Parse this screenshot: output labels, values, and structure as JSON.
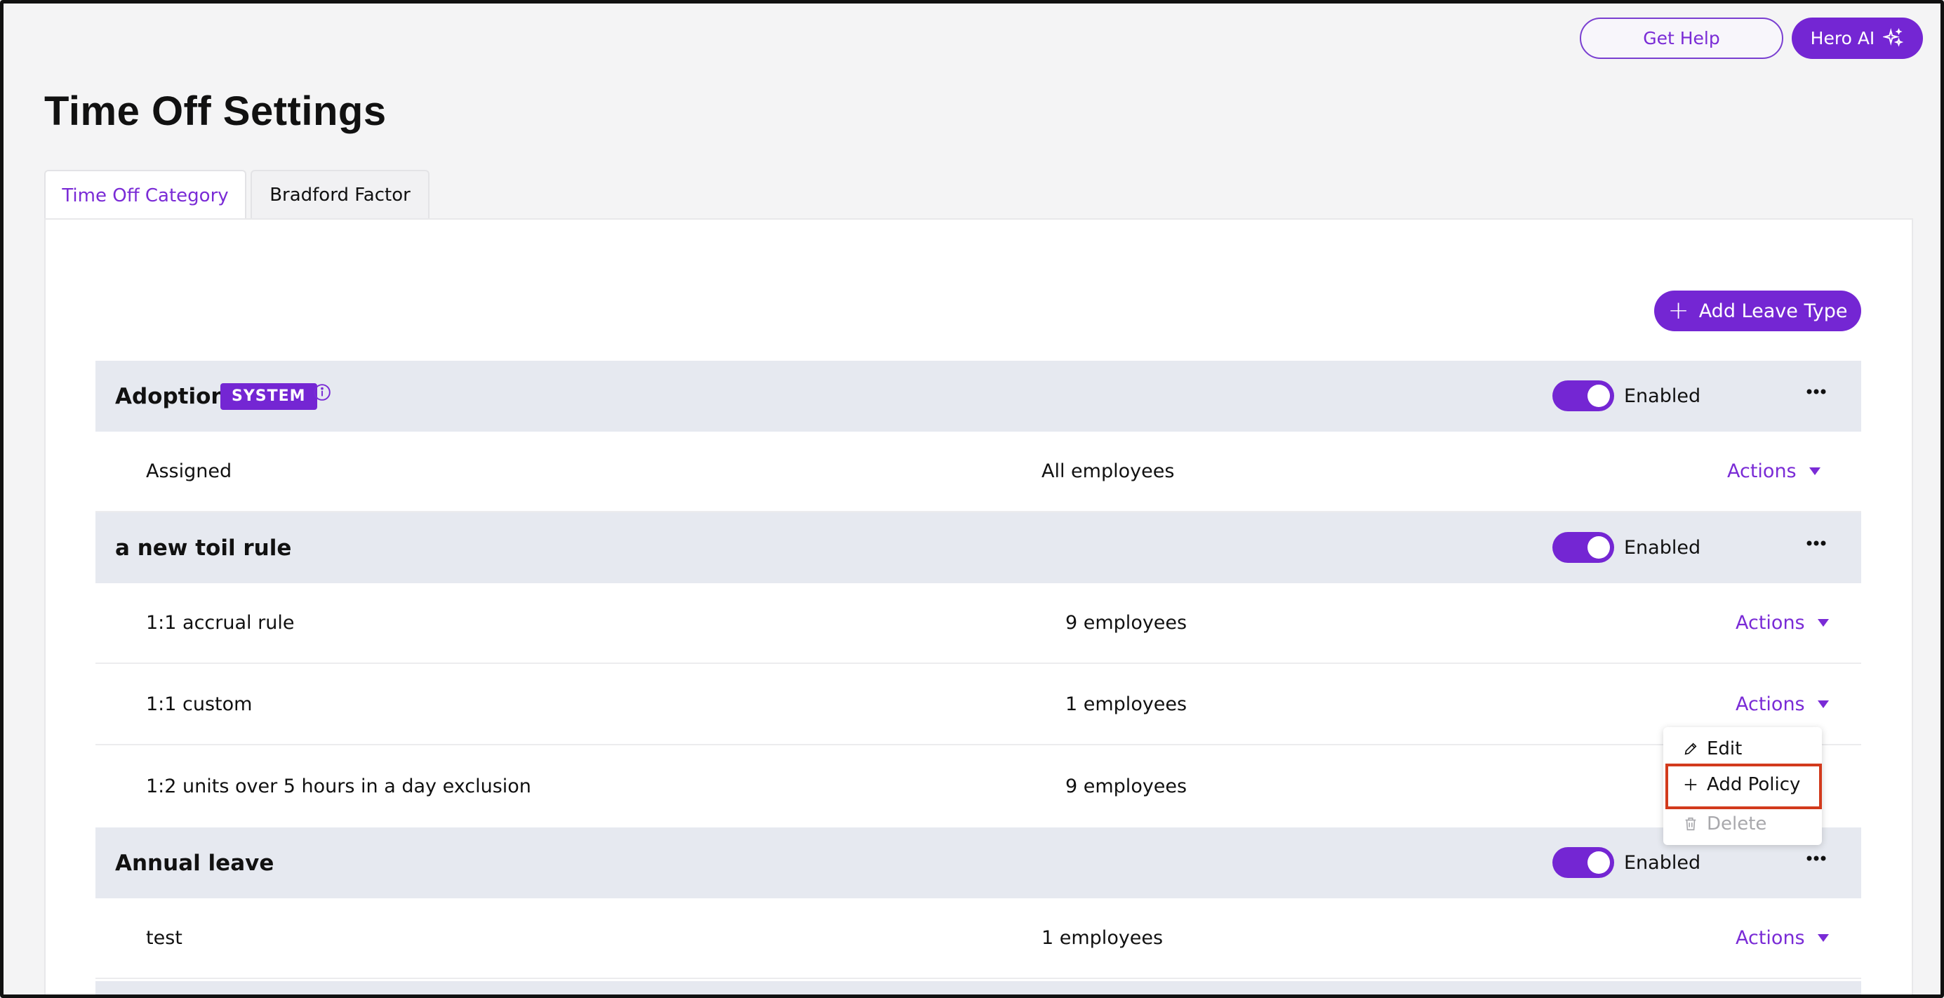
{
  "header": {
    "get_help_label": "Get Help",
    "hero_ai_label": "Hero AI"
  },
  "page": {
    "title": "Time Off Settings"
  },
  "tabs": [
    {
      "label": "Time Off Category",
      "active": true
    },
    {
      "label": "Bradford Factor",
      "active": false
    }
  ],
  "toolbar": {
    "add_leave_type_label": "Add Leave Type"
  },
  "groups": [
    {
      "name": "Adoption",
      "badge": "SYSTEM",
      "status": "Enabled",
      "enabled": true,
      "policies": [
        {
          "name": "Assigned",
          "count": "All employees",
          "actions_label": "Actions"
        }
      ]
    },
    {
      "name": "a new toil rule",
      "status": "Enabled",
      "enabled": true,
      "policies": [
        {
          "name": "1:1 accrual rule",
          "count": "9 employees",
          "actions_label": "Actions"
        },
        {
          "name": "1:1 custom",
          "count": "1 employees",
          "actions_label": "Actions"
        },
        {
          "name": "1:2 units over 5 hours in a day exclusion",
          "count": "9 employees",
          "actions_label": "Actions"
        }
      ]
    },
    {
      "name": "Annual leave",
      "status": "Enabled",
      "enabled": true,
      "policies": [
        {
          "name": "test",
          "count": "1 employees",
          "actions_label": "Actions"
        }
      ]
    }
  ],
  "dropdown": {
    "items": [
      {
        "label": "Edit",
        "icon": "pencil-icon",
        "disabled": false
      },
      {
        "label": "Add Policy",
        "icon": "plus-icon",
        "disabled": false,
        "highlighted": true
      },
      {
        "label": "Delete",
        "icon": "trash-icon",
        "disabled": true
      }
    ]
  },
  "colors": {
    "accent": "#7426d3",
    "group_row_bg": "#e6e9f0",
    "highlight": "#d23a1c"
  }
}
